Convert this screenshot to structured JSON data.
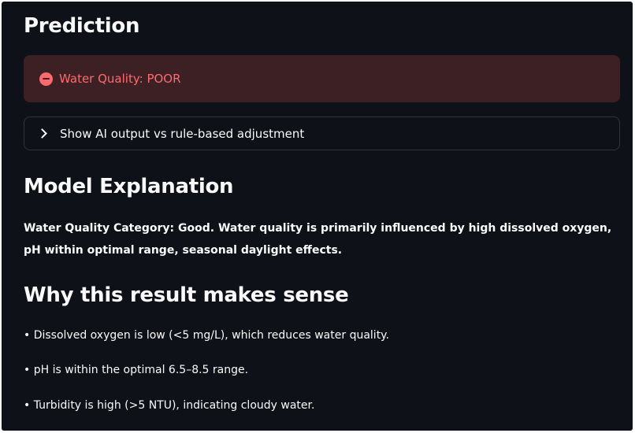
{
  "prediction": {
    "heading": "Prediction",
    "alert_text": "Water Quality: POOR",
    "alert_color": "#ff6a6f",
    "alert_bg": "#3d2023",
    "icon": "no-entry-icon"
  },
  "expander": {
    "label": "Show AI output vs rule-based adjustment",
    "icon": "chevron-right-icon",
    "expanded": false
  },
  "model_explanation": {
    "heading": "Model Explanation",
    "text": "Water Quality Category: Good. Water quality is primarily influenced by high dissolved oxygen, pH within optimal range, seasonal daylight effects."
  },
  "why": {
    "heading": "Why this result makes sense",
    "reasons": [
      "• Dissolved oxygen is low (<5 mg/L), which reduces water quality.",
      "• pH is within the optimal 6.5–8.5 range.",
      "• Turbidity is high (>5 NTU), indicating cloudy water."
    ]
  }
}
